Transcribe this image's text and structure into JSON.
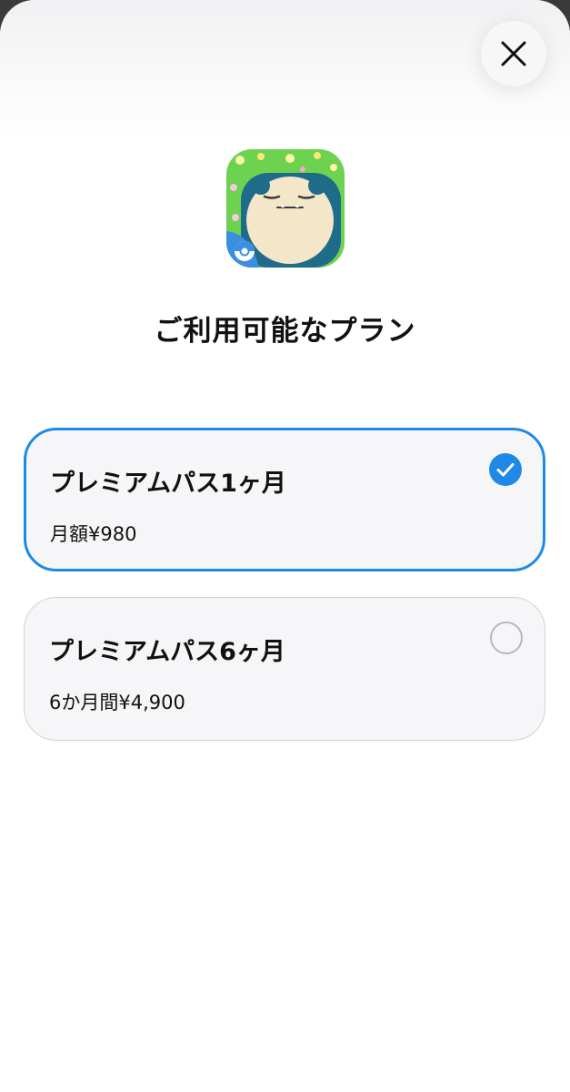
{
  "colors": {
    "accent": "#1e8ae6",
    "card_background": "#f6f6f8",
    "sheet_background": "#ffffff"
  },
  "header": {
    "close_icon": "close-icon"
  },
  "app_icon": {
    "icon": "app-icon-sleeping-character"
  },
  "title": "ご利用可能なプラン",
  "plans": [
    {
      "name": "プレミアムパス1ヶ月",
      "price": "月額¥980",
      "selected": true,
      "indicator_icon": "checkmark-circle-icon"
    },
    {
      "name": "プレミアムパス6ヶ月",
      "price": "6か月間¥4,900",
      "selected": false,
      "indicator_icon": "empty-circle-icon"
    }
  ]
}
